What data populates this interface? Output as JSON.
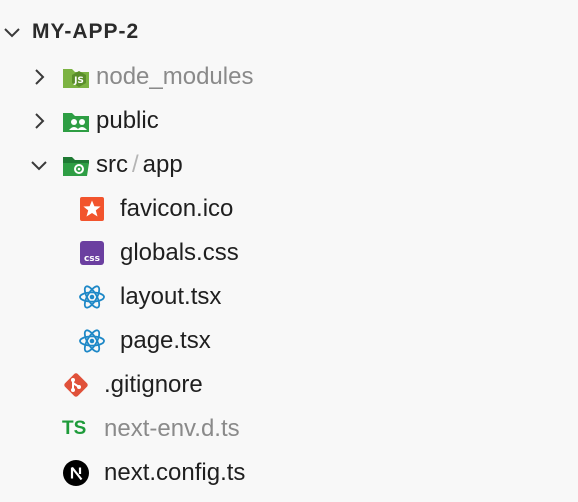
{
  "explorer": {
    "root": {
      "label": "MY-APP-2",
      "expanded": true
    },
    "items": [
      {
        "type": "folder",
        "label": "node_modules",
        "dimmed": true,
        "expanded": false,
        "icon": "folder-node-icon",
        "depth": 1
      },
      {
        "type": "folder",
        "label": "public",
        "dimmed": false,
        "expanded": false,
        "icon": "folder-public-icon",
        "depth": 1
      },
      {
        "type": "folder",
        "label_primary": "src",
        "label_separator": "/",
        "label_secondary": "app",
        "dimmed": false,
        "expanded": true,
        "icon": "folder-src-open-icon",
        "depth": 1
      },
      {
        "type": "file",
        "label": "favicon.ico",
        "icon": "favicon-star-icon",
        "depth": 2
      },
      {
        "type": "file",
        "label": "globals.css",
        "icon": "css-file-icon",
        "icon_text": "css",
        "depth": 2
      },
      {
        "type": "file",
        "label": "layout.tsx",
        "icon": "react-icon",
        "depth": 2
      },
      {
        "type": "file",
        "label": "page.tsx",
        "icon": "react-icon",
        "depth": 2
      },
      {
        "type": "file",
        "label": ".gitignore",
        "icon": "git-icon",
        "depth": 1
      },
      {
        "type": "file",
        "label": "next-env.d.ts",
        "dimmed": true,
        "icon": "typescript-icon",
        "icon_text": "TS",
        "depth": 1
      },
      {
        "type": "file",
        "label": "next.config.ts",
        "icon": "nextjs-icon",
        "depth": 1
      }
    ]
  },
  "colors": {
    "background": "#f8f8f8",
    "text": "#1f1f1f",
    "dimmed_text": "#8a8a8a",
    "folder_green": "#2e9e44",
    "react_blue": "#1e88c7",
    "css_purple": "#6b3fa0",
    "git_red": "#e0513a",
    "favicon_orange": "#f2542d",
    "ts_green": "#1e9b3a"
  }
}
